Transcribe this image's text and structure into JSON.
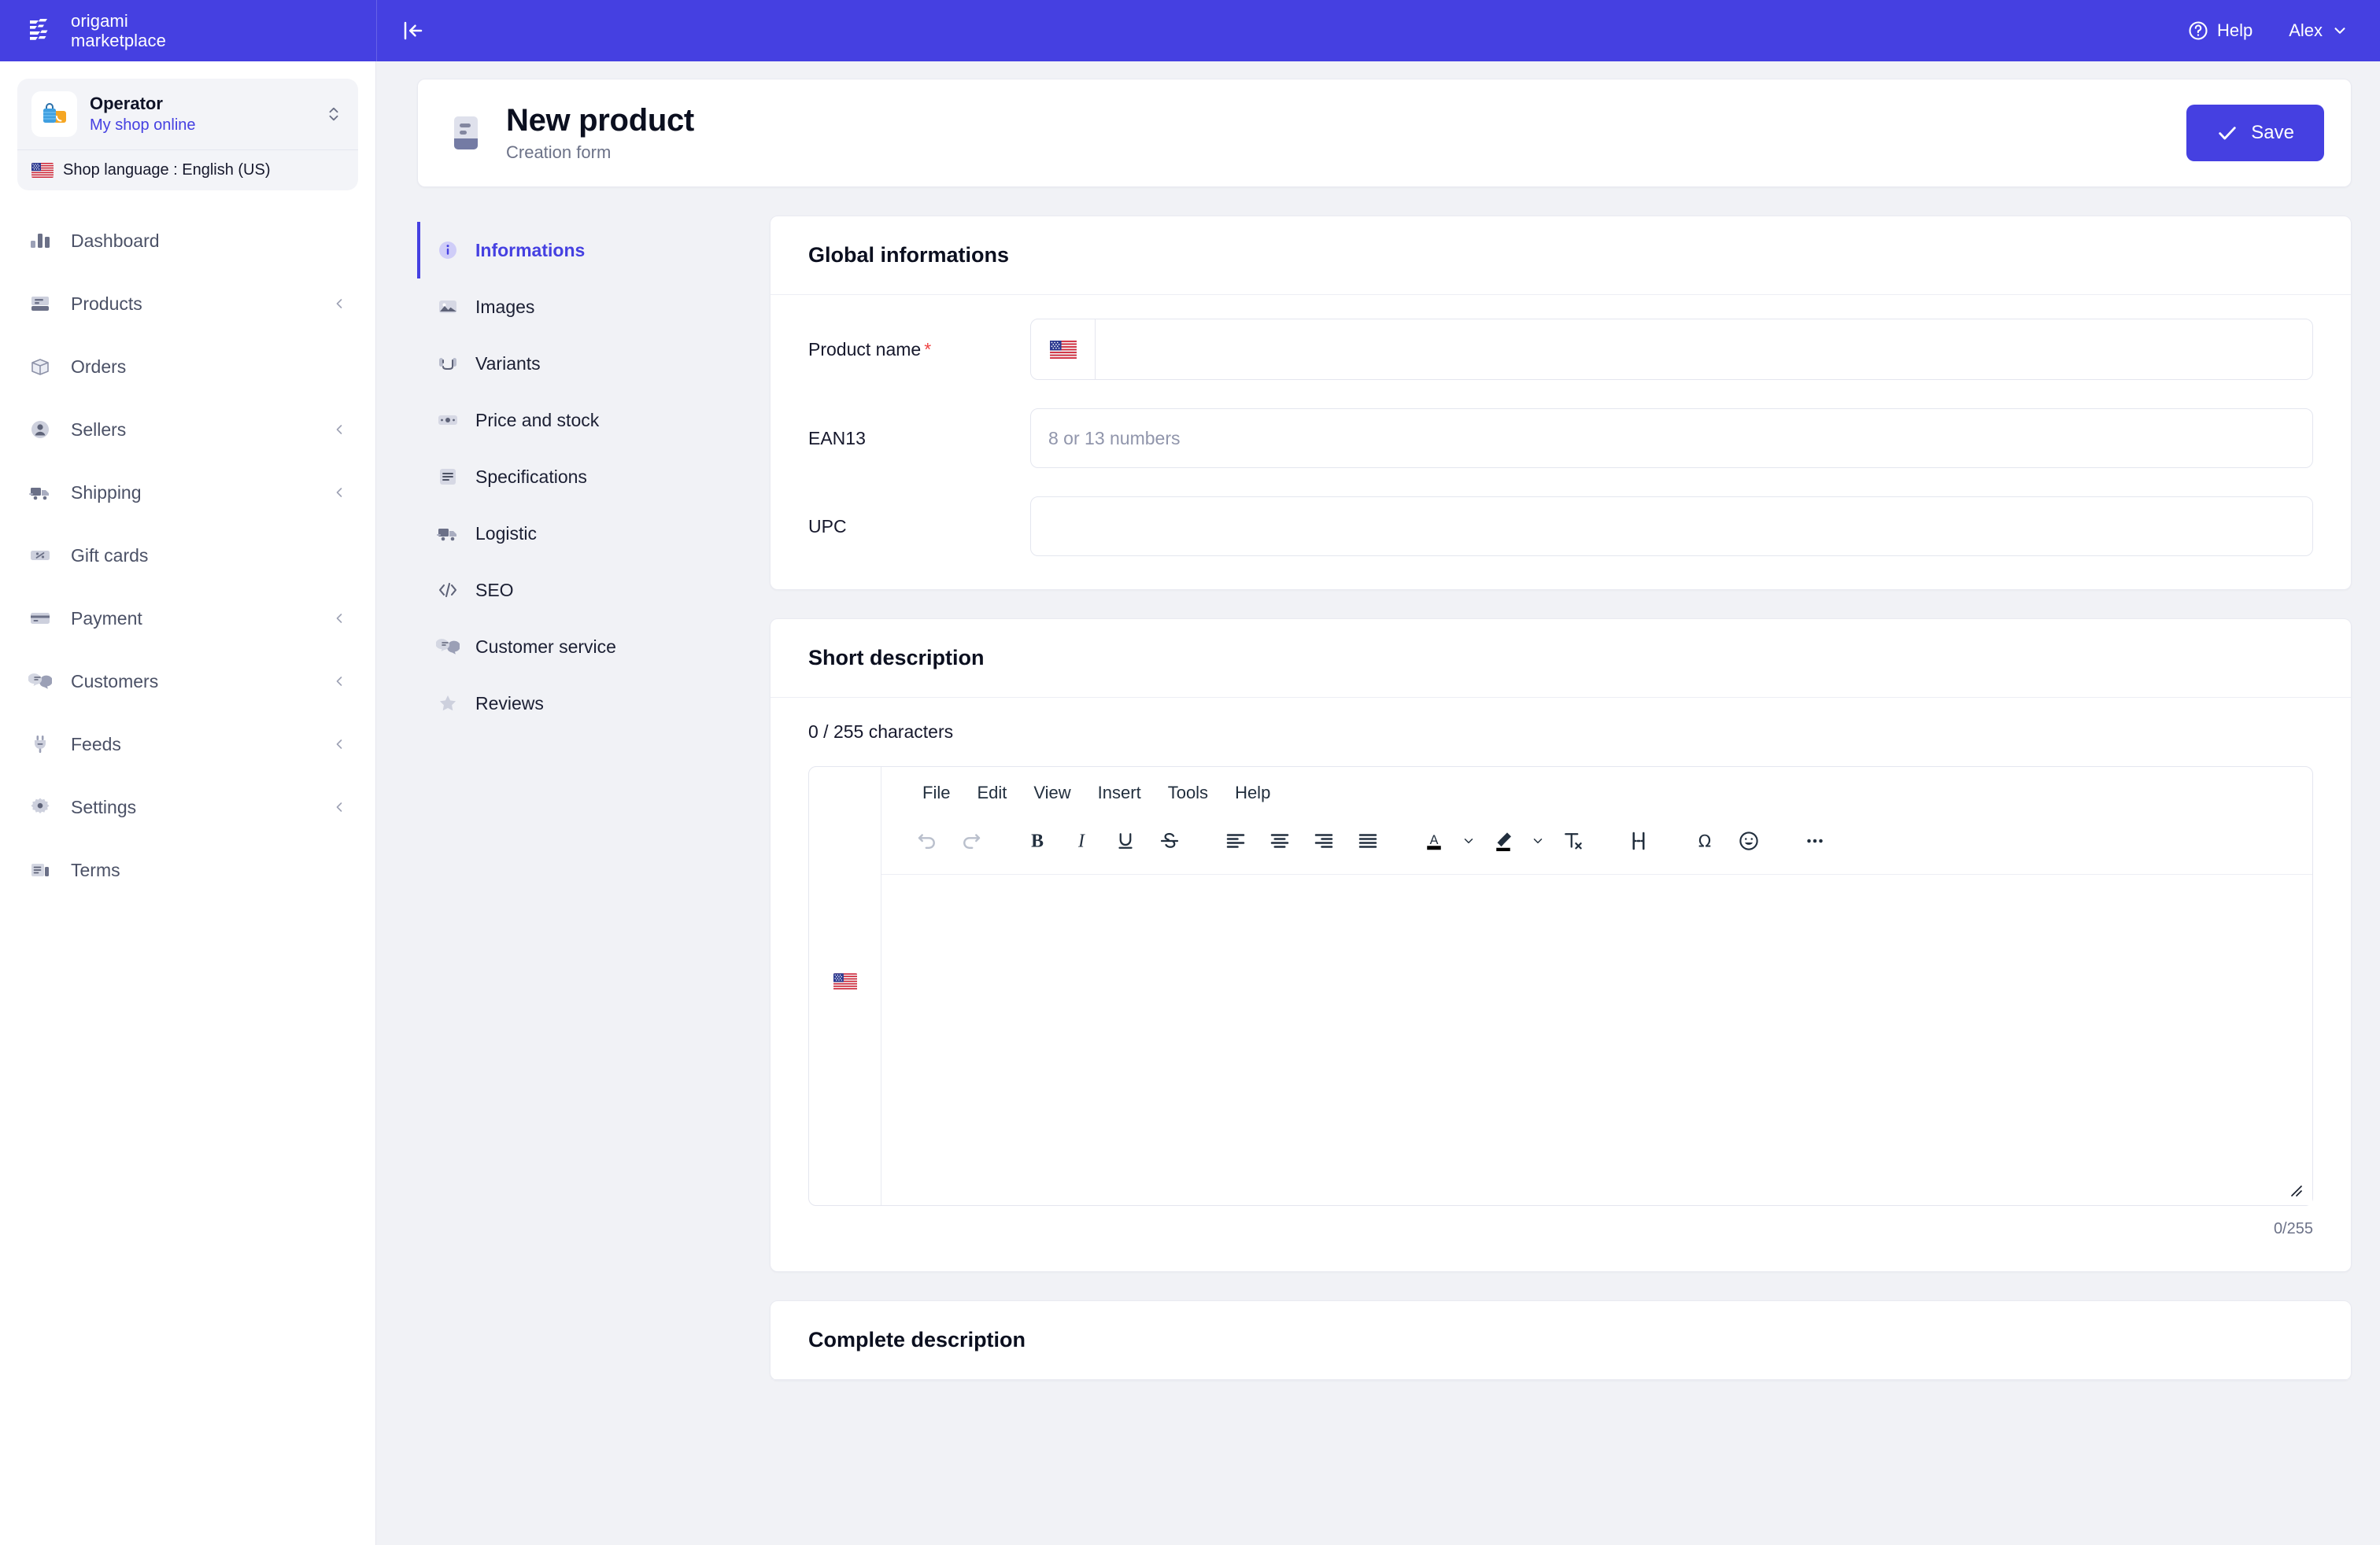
{
  "brand": {
    "line1": "origami",
    "line2": "marketplace",
    "logo_icon": "origami-logo-icon"
  },
  "topbar": {
    "collapse_icon": "collapse-sidebar-icon",
    "help_label": "Help",
    "help_icon": "question-circle-icon",
    "user_label": "Alex",
    "user_caret_icon": "chevron-down-icon",
    "background": "#4540e1"
  },
  "sidebar": {
    "shop": {
      "name": "Operator",
      "subtitle": "My shop online",
      "avatar_icon": "shopping-bag-icon",
      "switcher_icon": "chevron-up-down-icon"
    },
    "language": {
      "label": "Shop language : English (US)",
      "flag_icon": "flag-us-icon"
    },
    "items": [
      {
        "label": "Dashboard",
        "icon": "bar-chart-icon",
        "expandable": false
      },
      {
        "label": "Products",
        "icon": "box-stack-icon",
        "expandable": true
      },
      {
        "label": "Orders",
        "icon": "package-icon",
        "expandable": false
      },
      {
        "label": "Sellers",
        "icon": "user-circle-icon",
        "expandable": true
      },
      {
        "label": "Shipping",
        "icon": "truck-icon",
        "expandable": true
      },
      {
        "label": "Gift cards",
        "icon": "ticket-percent-icon",
        "expandable": false
      },
      {
        "label": "Payment",
        "icon": "credit-card-icon",
        "expandable": true
      },
      {
        "label": "Customers",
        "icon": "chat-bubble-icon",
        "expandable": true
      },
      {
        "label": "Feeds",
        "icon": "plug-icon",
        "expandable": true
      },
      {
        "label": "Settings",
        "icon": "gear-icon",
        "expandable": true
      },
      {
        "label": "Terms",
        "icon": "document-list-icon",
        "expandable": false
      }
    ],
    "caret_icon": "chevron-left-icon"
  },
  "page": {
    "title": "New product",
    "subtitle": "Creation form",
    "icon": "product-card-icon",
    "save_label": "Save",
    "save_icon": "check-icon",
    "accent_color": "#4540e1"
  },
  "section_nav": {
    "items": [
      {
        "label": "Informations",
        "icon": "info-circle-icon",
        "active": true
      },
      {
        "label": "Images",
        "icon": "image-icon",
        "active": false
      },
      {
        "label": "Variants",
        "icon": "variants-icon",
        "active": false
      },
      {
        "label": "Price and stock",
        "icon": "price-tag-icon",
        "active": false
      },
      {
        "label": "Specifications",
        "icon": "list-lines-icon",
        "active": false
      },
      {
        "label": "Logistic",
        "icon": "truck-icon",
        "active": false
      },
      {
        "label": "SEO",
        "icon": "code-brackets-icon",
        "active": false
      },
      {
        "label": "Customer service",
        "icon": "chat-bubble-icon",
        "active": false
      },
      {
        "label": "Reviews",
        "icon": "star-icon",
        "active": false
      }
    ]
  },
  "global_information": {
    "card_title": "Global informations",
    "fields": [
      {
        "label": "Product name",
        "required": true,
        "value": "",
        "placeholder": "",
        "flag_icon": "flag-us-icon",
        "has_flag": true
      },
      {
        "label": "EAN13",
        "required": false,
        "value": "",
        "placeholder": "8 or 13 numbers",
        "has_flag": false
      },
      {
        "label": "UPC",
        "required": false,
        "value": "",
        "placeholder": "",
        "has_flag": false
      }
    ]
  },
  "short_description": {
    "card_title": "Short description",
    "char_counter": "0 / 255 characters",
    "footer_counter": "0/255",
    "flag_icon": "flag-us-icon",
    "editor": {
      "menubar": [
        "File",
        "Edit",
        "View",
        "Insert",
        "Tools",
        "Help"
      ],
      "toolbar": [
        {
          "name": "undo-icon",
          "disabled": true
        },
        {
          "name": "redo-icon",
          "disabled": true
        },
        {
          "name": "bold-icon",
          "disabled": false
        },
        {
          "name": "italic-icon",
          "disabled": false
        },
        {
          "name": "underline-icon",
          "disabled": false
        },
        {
          "name": "strikethrough-icon",
          "disabled": false
        },
        {
          "name": "align-left-icon",
          "disabled": false
        },
        {
          "name": "align-center-icon",
          "disabled": false
        },
        {
          "name": "align-right-icon",
          "disabled": false
        },
        {
          "name": "align-justify-icon",
          "disabled": false
        },
        {
          "name": "text-color-icon",
          "disabled": false
        },
        {
          "name": "background-color-icon",
          "disabled": false
        },
        {
          "name": "clear-formatting-icon",
          "disabled": false
        },
        {
          "name": "line-height-icon",
          "disabled": false
        },
        {
          "name": "special-character-icon",
          "disabled": false
        },
        {
          "name": "emoticon-icon",
          "disabled": false
        },
        {
          "name": "more-options-icon",
          "disabled": false
        }
      ],
      "content": "",
      "resize_handle_icon": "resize-grip-icon"
    }
  },
  "complete_description": {
    "card_title": "Complete description"
  }
}
